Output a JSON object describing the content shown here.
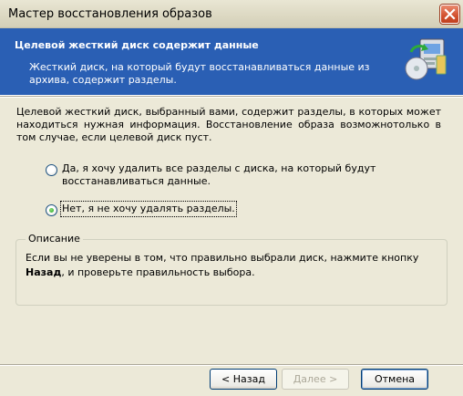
{
  "window": {
    "title": "Мастер восстановления образов"
  },
  "banner": {
    "title": "Целевой жесткий диск содержит данные",
    "subtitle": "Жесткий диск, на который будут восстанавливаться данные из архива, содержит разделы."
  },
  "intro": "Целевой жесткий диск, выбранный вами, содержит разделы, в которых может находиться нужная информация. Восстановление образа возможнотолько в том случае, если целевой диск пуст.",
  "options": [
    {
      "label": "Да, я хочу удалить все разделы с диска, на который будут восстанавливаться данные.",
      "selected": false
    },
    {
      "label": "Нет, я не хочу удалять разделы.",
      "selected": true
    }
  ],
  "description": {
    "legend": "Описание",
    "text_before": "Если вы не уверены в том, что правильно выбрали диск, нажмите кнопку ",
    "text_bold": "Назад",
    "text_after": ", и проверьте правильность выбора."
  },
  "buttons": {
    "back": "< Назад",
    "next": "Далее >",
    "cancel": "Отмена"
  },
  "colors": {
    "banner_bg": "#2A5FB4",
    "dialog_bg": "#ECE9D8",
    "close_button": "#D2512E"
  }
}
